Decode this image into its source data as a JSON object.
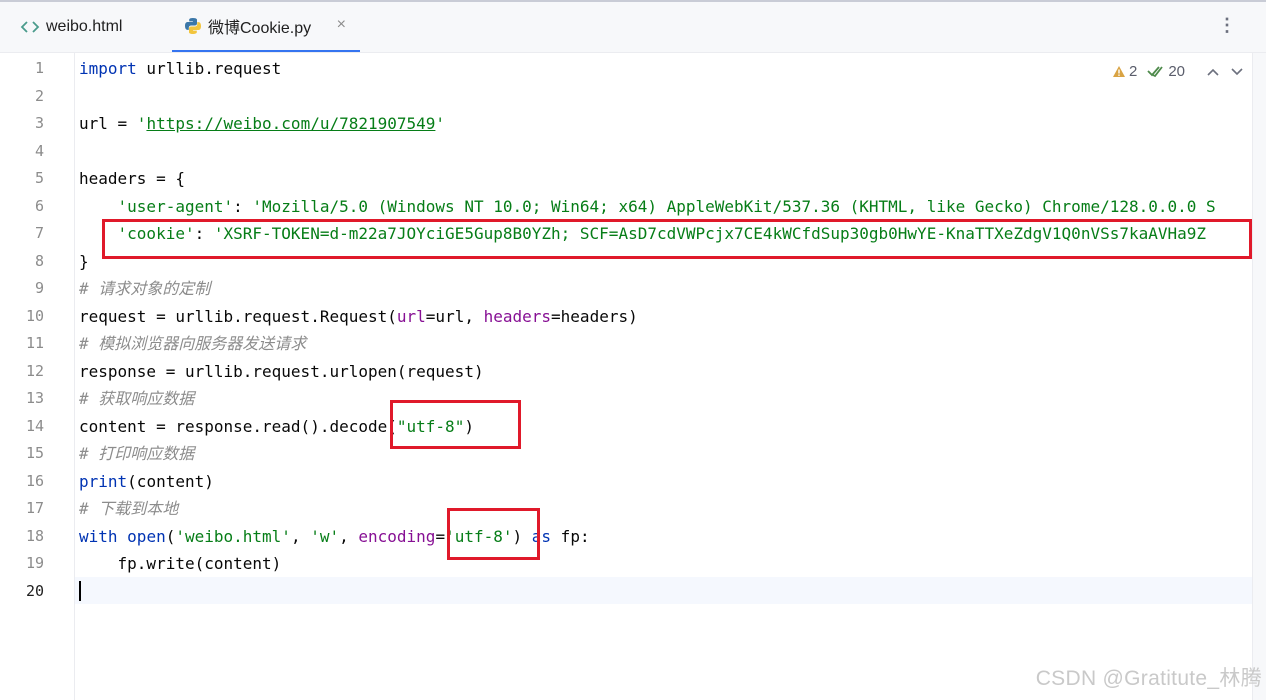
{
  "tabs": [
    {
      "label": "weibo.html",
      "icon": "html-tag-icon",
      "active": false
    },
    {
      "label": "微博Cookie.py",
      "icon": "python-icon",
      "active": true
    }
  ],
  "tab_close_glyph": "×",
  "menu_glyph": "⋮",
  "inspections": {
    "warnings": "2",
    "weak_warnings": "20"
  },
  "code_lines": [
    {
      "n": "1",
      "tokens": [
        [
          "kw",
          "import"
        ],
        [
          "p",
          " urllib.request"
        ]
      ]
    },
    {
      "n": "2",
      "tokens": []
    },
    {
      "n": "3",
      "tokens": [
        [
          "p",
          "url = "
        ],
        [
          "str",
          "'"
        ],
        [
          "url",
          "https://weibo.com/u/7821907549"
        ],
        [
          "str",
          "'"
        ]
      ]
    },
    {
      "n": "4",
      "tokens": []
    },
    {
      "n": "5",
      "tokens": [
        [
          "p",
          "headers = {"
        ]
      ]
    },
    {
      "n": "6",
      "tokens": [
        [
          "p",
          "    "
        ],
        [
          "str",
          "'user-agent'"
        ],
        [
          "p",
          ": "
        ],
        [
          "str",
          "'Mozilla/5.0 (Windows NT 10.0; Win64; x64) AppleWebKit/537.36 (KHTML, like Gecko) Chrome/128.0.0.0 S"
        ]
      ]
    },
    {
      "n": "7",
      "tokens": [
        [
          "p",
          "    "
        ],
        [
          "str",
          "'cookie'"
        ],
        [
          "p",
          ": "
        ],
        [
          "str",
          "'XSRF-TOKEN=d-m22a7JOYciGE5Gup8B0YZh; SCF=AsD7cdVWPcjx7CE4kWCfdSup30gb0HwYE-KnaTTXeZdgV1Q0nVSs7kaAVHa9Z"
        ]
      ]
    },
    {
      "n": "8",
      "tokens": [
        [
          "p",
          "}"
        ]
      ]
    },
    {
      "n": "9",
      "tokens": [
        [
          "cmt",
          "# 请求对象的定制"
        ]
      ]
    },
    {
      "n": "10",
      "tokens": [
        [
          "p",
          "request = urllib.request.Request("
        ],
        [
          "param",
          "url"
        ],
        [
          "p",
          "=url, "
        ],
        [
          "param",
          "headers"
        ],
        [
          "p",
          "=headers)"
        ]
      ]
    },
    {
      "n": "11",
      "tokens": [
        [
          "cmt",
          "# 模拟浏览器向服务器发送请求"
        ]
      ]
    },
    {
      "n": "12",
      "tokens": [
        [
          "p",
          "response = urllib.request.urlopen(request)"
        ]
      ]
    },
    {
      "n": "13",
      "tokens": [
        [
          "cmt",
          "# 获取响应数据"
        ]
      ]
    },
    {
      "n": "14",
      "tokens": [
        [
          "p",
          "content = response.read().decode("
        ],
        [
          "str",
          "\"utf-8\""
        ],
        [
          "p",
          ")"
        ]
      ]
    },
    {
      "n": "15",
      "tokens": [
        [
          "cmt",
          "# 打印响应数据"
        ]
      ]
    },
    {
      "n": "16",
      "tokens": [
        [
          "fn",
          "print"
        ],
        [
          "p",
          "(content)"
        ]
      ]
    },
    {
      "n": "17",
      "tokens": [
        [
          "cmt",
          "# 下载到本地"
        ]
      ]
    },
    {
      "n": "18",
      "tokens": [
        [
          "kw",
          "with"
        ],
        [
          "p",
          " "
        ],
        [
          "fn",
          "open"
        ],
        [
          "p",
          "("
        ],
        [
          "str",
          "'weibo.html'"
        ],
        [
          "p",
          ", "
        ],
        [
          "str",
          "'w'"
        ],
        [
          "p",
          ", "
        ],
        [
          "param",
          "encoding"
        ],
        [
          "p",
          "="
        ],
        [
          "str",
          "'utf-8'"
        ],
        [
          "p",
          ") "
        ],
        [
          "kw",
          "as"
        ],
        [
          "p",
          " fp:"
        ]
      ]
    },
    {
      "n": "19",
      "tokens": [
        [
          "p",
          "    fp.write(content)"
        ]
      ]
    },
    {
      "n": "20",
      "tokens": []
    }
  ],
  "current_line": "20",
  "watermark": "CSDN @Gratitute_林腾",
  "colors": {
    "keyword": "#0033b3",
    "string": "#067d17",
    "comment": "#8c8c8c",
    "param": "#871094",
    "highlight_box": "#e0192a",
    "tab_underline": "#3574f0"
  }
}
